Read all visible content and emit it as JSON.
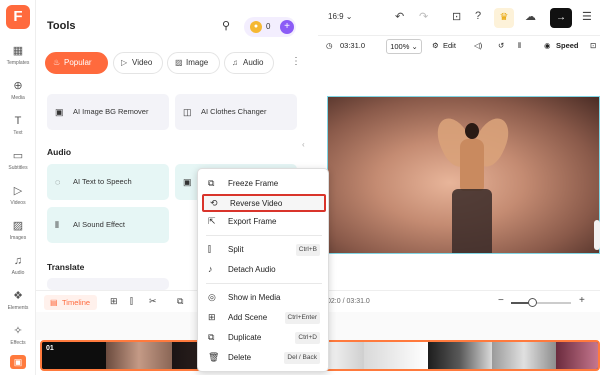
{
  "sidebar": {
    "logo": "F",
    "items": [
      {
        "label": "Templates",
        "icon": "▦"
      },
      {
        "label": "Media",
        "icon": "⊕"
      },
      {
        "label": "Text",
        "icon": "T"
      },
      {
        "label": "Subtitles",
        "icon": "▭"
      },
      {
        "label": "Videos",
        "icon": "▷"
      },
      {
        "label": "Images",
        "icon": "▨"
      },
      {
        "label": "Audio",
        "icon": "♫"
      },
      {
        "label": "Elements",
        "icon": "❖"
      },
      {
        "label": "Effects",
        "icon": "✧"
      }
    ],
    "bag_icon": "▣"
  },
  "tools_panel": {
    "title": "Tools",
    "coins": "0",
    "tabs": [
      {
        "label": "Popular",
        "icon": "♨"
      },
      {
        "label": "Video",
        "icon": "▷"
      },
      {
        "label": "Image",
        "icon": "▨"
      },
      {
        "label": "Audio",
        "icon": "♫"
      }
    ],
    "tabs_more": "⋮",
    "cards_top": [
      "AI Image BG Remover",
      "AI Clothes Changer"
    ],
    "section_audio": "Audio",
    "audio_cards": [
      "AI Text to Speech",
      "AI Sound Effect"
    ],
    "section_translate": "Translate"
  },
  "topbar": {
    "aspect_ratio": "16:9 ⌄",
    "undo": "↶",
    "redo": "↷",
    "icons": [
      "⊡",
      "?",
      "♛",
      "☁",
      "→",
      "☰"
    ]
  },
  "subbar": {
    "duration": "03:31.0",
    "zoom": "100% ⌄",
    "edit": "Edit",
    "speed": "Speed"
  },
  "timeline": {
    "label": "Timeline",
    "time": "02:0 / 03:31.0",
    "zoom_level_fraction": 0.35,
    "clip_label": "01"
  },
  "context_menu": {
    "items": [
      {
        "label": "Freeze Frame",
        "icon": "⧉",
        "shortcut": ""
      },
      {
        "label": "Reverse Video",
        "icon": "⟲",
        "shortcut": ""
      },
      {
        "label": "Export Frame",
        "icon": "⇱",
        "shortcut": ""
      },
      {
        "label": "Split",
        "icon": "⫿",
        "shortcut": "Ctrl+B"
      },
      {
        "label": "Detach Audio",
        "icon": "♪",
        "shortcut": ""
      },
      {
        "label": "Show in Media",
        "icon": "◎",
        "shortcut": ""
      },
      {
        "label": "Add Scene",
        "icon": "⊞",
        "shortcut": "Ctrl+Enter"
      },
      {
        "label": "Duplicate",
        "icon": "⧉",
        "shortcut": "Ctrl+D"
      },
      {
        "label": "Delete",
        "icon": "🗑",
        "shortcut": "Del / Back"
      }
    ],
    "highlighted": "Reverse Video"
  },
  "colors": {
    "accent": "#ff6a3d",
    "highlight_border": "#d9342b",
    "purple": "#8b5cf6"
  }
}
